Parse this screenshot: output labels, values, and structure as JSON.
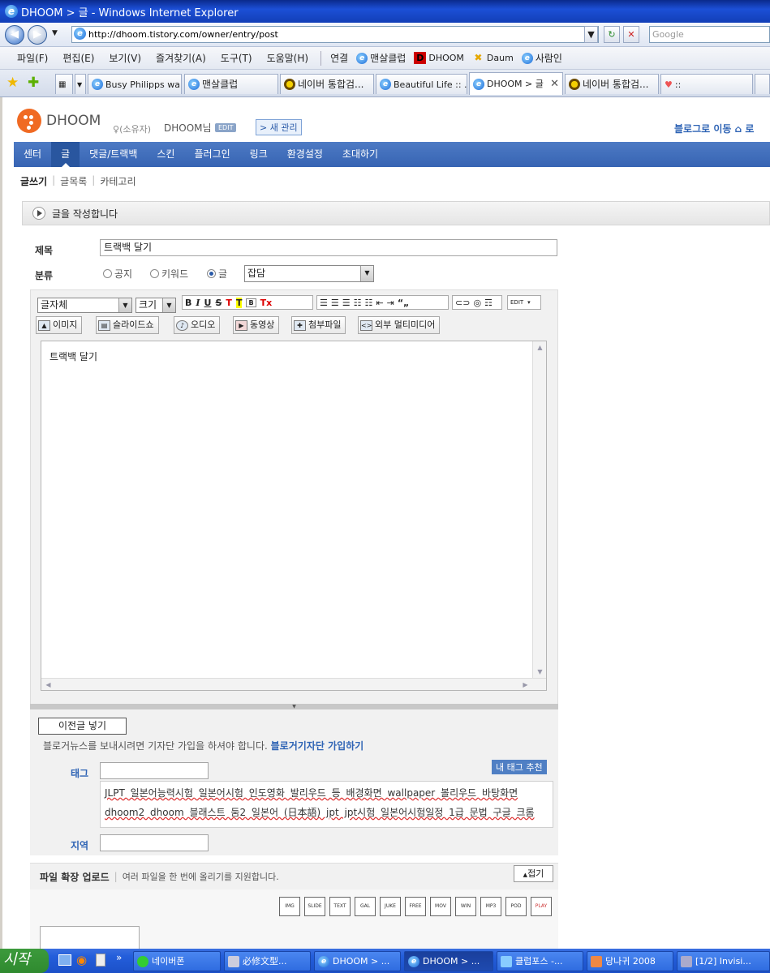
{
  "window": {
    "title": "DHOOM > 글 - Windows Internet Explorer"
  },
  "browser": {
    "address": "http://dhoom.tistory.com/owner/entry/post",
    "search_placeholder": "Google",
    "menu": [
      "파일(F)",
      "편집(E)",
      "보기(V)",
      "즐겨찾기(A)",
      "도구(T)",
      "도움말(H)"
    ],
    "links": [
      "연결",
      "맨살클럽",
      "DHOOM",
      "Daum",
      "사람인"
    ],
    "tabs": [
      "Busy Philipps wa...",
      "맨살클럽",
      "네이버 통합검...",
      "Beautiful Life :: ...",
      "DHOOM > 글",
      "네이버 통합검...",
      "::"
    ]
  },
  "blog": {
    "logo": "DHOOM",
    "owner_label": "(소유자)",
    "owner_name": "DHOOM님",
    "edit_badge": "EDIT",
    "new_manage": "> 새 관리",
    "to_blog": "블로그로 이동",
    "to_blog_tail": "로",
    "gnb": [
      "센터",
      "글",
      "댓글/트랙백",
      "스킨",
      "플러그인",
      "링크",
      "환경설정",
      "초대하기"
    ],
    "lnb": [
      "글쓰기",
      "글목록",
      "카테고리"
    ],
    "guide": "글을 작성합니다"
  },
  "form": {
    "title_label": "제목",
    "title_value": "트랙백 달기",
    "category_label": "분류",
    "radios": [
      "공지",
      "키워드",
      "글"
    ],
    "category_value": "잡담",
    "font_select": "글자체",
    "size_select": "크기",
    "fmt": [
      "B",
      "I",
      "U",
      "S",
      "T",
      "T",
      "B",
      "Tx"
    ],
    "edit_toggle": "EDIT",
    "media_buttons": [
      "이미지",
      "슬라이드쇼",
      "오디오",
      "동영상",
      "첨부파일",
      "외부 멀티미디어"
    ],
    "body_text": "트랙백 달기",
    "prev_post_btn": "이전글 넣기",
    "reporter_text": "블로거뉴스를 보내시려면 기자단 가입을 하셔야 합니다.",
    "reporter_link": "블로거기자단 가입하기",
    "tag_label": "태그",
    "tag_recommend": "내 태그 추천",
    "tag_cloud": "JLPT 일본어능력시험 일본어시험 인도영화 발리우드 등 배경화면 wallpaper 볼리우드 바탕화면 dhoom2 dhoom 블래스트 둠2 일본어 (日本語) jpt jpt시험 일본어시험일정 1급 문법 구글 크롬",
    "location_label": "지역",
    "upload_title": "파일 확장 업로드",
    "upload_desc": "여러 파일을 한 번에 올리기를 지원합니다.",
    "fold_btn": "접기",
    "media_types": [
      "IMG",
      "SLIDE",
      "TEXT",
      "GAL",
      "JUKE",
      "FREE",
      "MOV",
      "WIN",
      "MP3",
      "POD",
      "PLAY"
    ]
  },
  "taskbar": {
    "start": "시작",
    "items": [
      "네이버폰",
      "必修文型...",
      "DHOOM > ...",
      "DHOOM > ...",
      "클럽포스 -...",
      "당나귀 2008",
      "[1/2] Invisi..."
    ]
  },
  "colors": {
    "accent": "#3764b3",
    "titlebar": "#1c4fd6",
    "logo": "#f06a23"
  }
}
